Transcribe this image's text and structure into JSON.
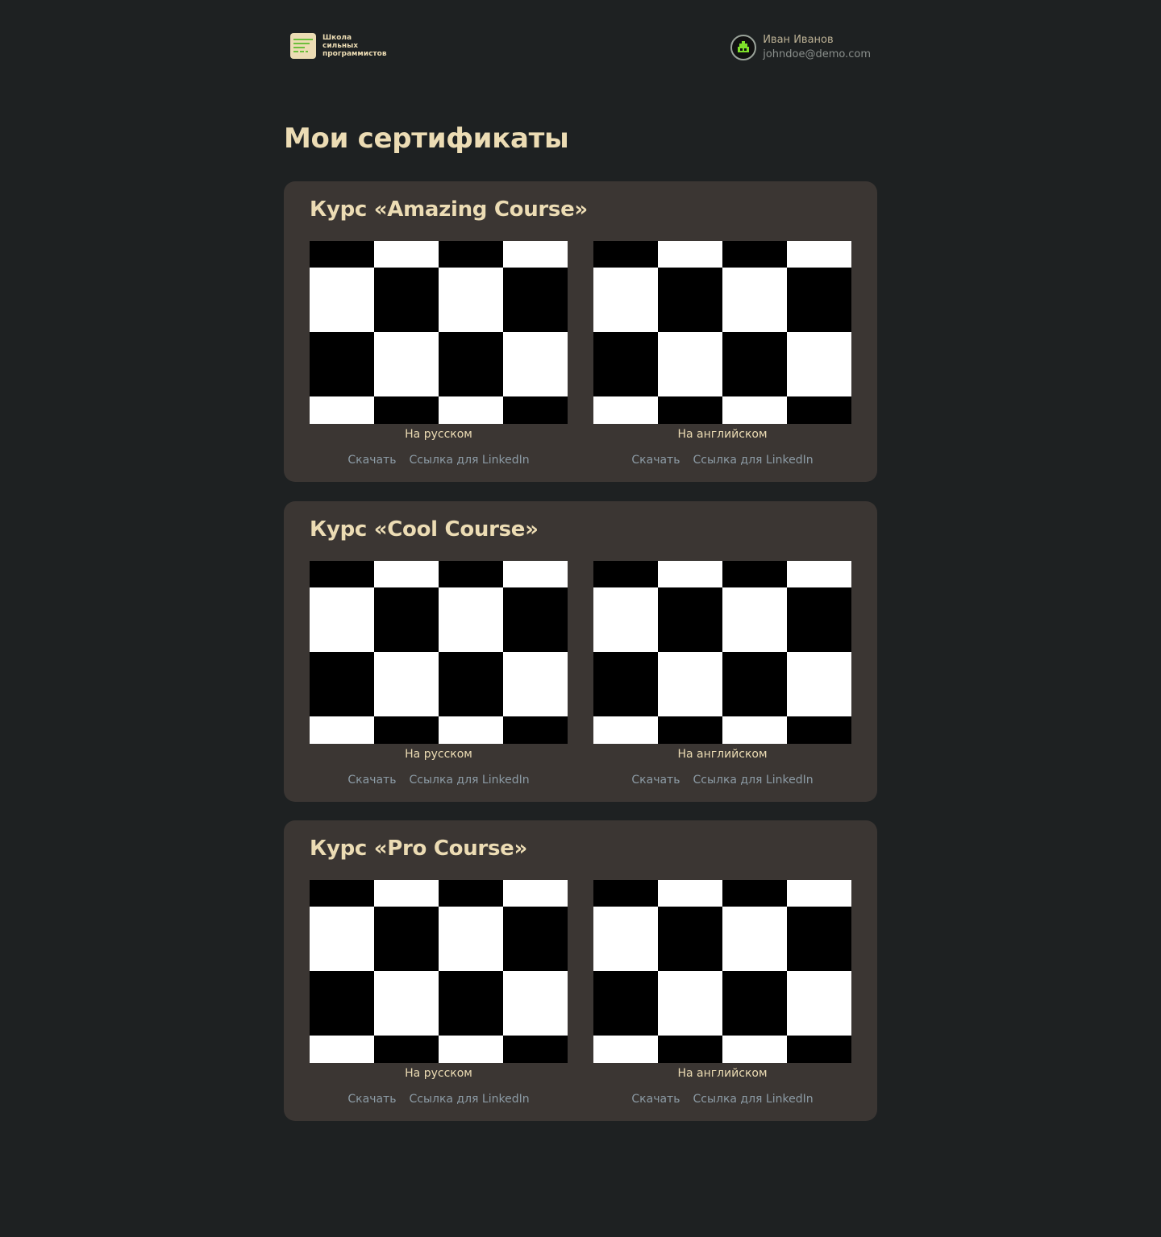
{
  "brand": {
    "logo_lines": [
      "Школа",
      "сильных",
      "программистов"
    ]
  },
  "user": {
    "name": "Иван Иванов",
    "email": "johndoe@demo.com"
  },
  "page": {
    "title": "Мои сертификаты"
  },
  "colors": {
    "background": "#1e2122",
    "card": "#3b3633",
    "accent_text": "#ecdcb4",
    "link": "#8c9ba5",
    "logo_green": "#6cbf3c"
  },
  "courses": [
    {
      "title": "Курс «Amazing Course»",
      "certificates": [
        {
          "label": "На русском",
          "download": "Скачать",
          "linkedin": "Ссылка для LinkedIn"
        },
        {
          "label": "На английском",
          "download": "Скачать",
          "linkedin": "Ссылка для LinkedIn"
        }
      ]
    },
    {
      "title": "Курс «Cool Course»",
      "certificates": [
        {
          "label": "На русском",
          "download": "Скачать",
          "linkedin": "Ссылка для LinkedIn"
        },
        {
          "label": "На английском",
          "download": "Скачать",
          "linkedin": "Ссылка для LinkedIn"
        }
      ]
    },
    {
      "title": "Курс «Pro Course»",
      "certificates": [
        {
          "label": "На русском",
          "download": "Скачать",
          "linkedin": "Ссылка для LinkedIn"
        },
        {
          "label": "На английском",
          "download": "Скачать",
          "linkedin": "Ссылка для LinkedIn"
        }
      ]
    }
  ]
}
